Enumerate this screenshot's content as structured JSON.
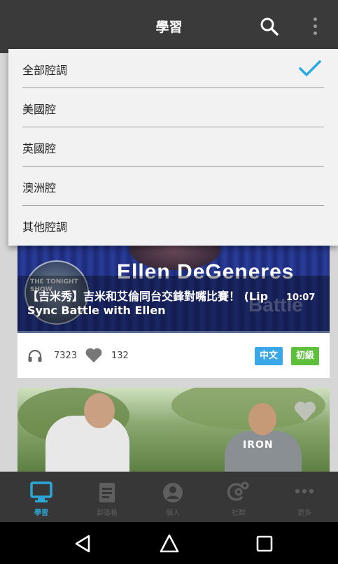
{
  "topbar": {
    "title": "學習",
    "search_icon": "search-icon",
    "more_icon": "more-vert-icon"
  },
  "dropdown": {
    "items": [
      {
        "label": "全部腔調",
        "selected": true
      },
      {
        "label": "美國腔",
        "selected": false
      },
      {
        "label": "英國腔",
        "selected": false
      },
      {
        "label": "澳洲腔",
        "selected": false
      },
      {
        "label": "其他腔調",
        "selected": false
      }
    ],
    "check_icon": "check-icon",
    "accent_color": "#2aa8e0"
  },
  "feed": {
    "cards": [
      {
        "title": "【吉米秀】吉米和艾倫同台交鋒對嘴比賽！ (Lip Sync Battle with Ellen",
        "thumb_text": "Ellen DeGeneres",
        "thumb_text_2": "Battle",
        "logo_text": "THE TONIGHT SHOW",
        "duration": "10:07",
        "listens": "7323",
        "likes": "132",
        "language_badge": "中文",
        "level_badge": "初級"
      },
      {
        "thumb_text": "IRON"
      }
    ],
    "badge_colors": {
      "language": "#3aa8e8",
      "level": "#5ec03a"
    }
  },
  "tabbar": {
    "tabs": [
      {
        "label": "學習",
        "icon": "monitor-icon",
        "active": true
      },
      {
        "label": "部落格",
        "icon": "document-icon",
        "active": false
      },
      {
        "label": "個人",
        "icon": "person-icon",
        "active": false
      },
      {
        "label": "社群",
        "icon": "community-icon",
        "active": false
      },
      {
        "label": "更多",
        "icon": "more-horiz-icon",
        "active": false
      }
    ],
    "active_color": "#2aa8d8"
  },
  "navbar": {
    "back_icon": "back-icon",
    "home_icon": "home-icon",
    "recents_icon": "recents-icon"
  }
}
